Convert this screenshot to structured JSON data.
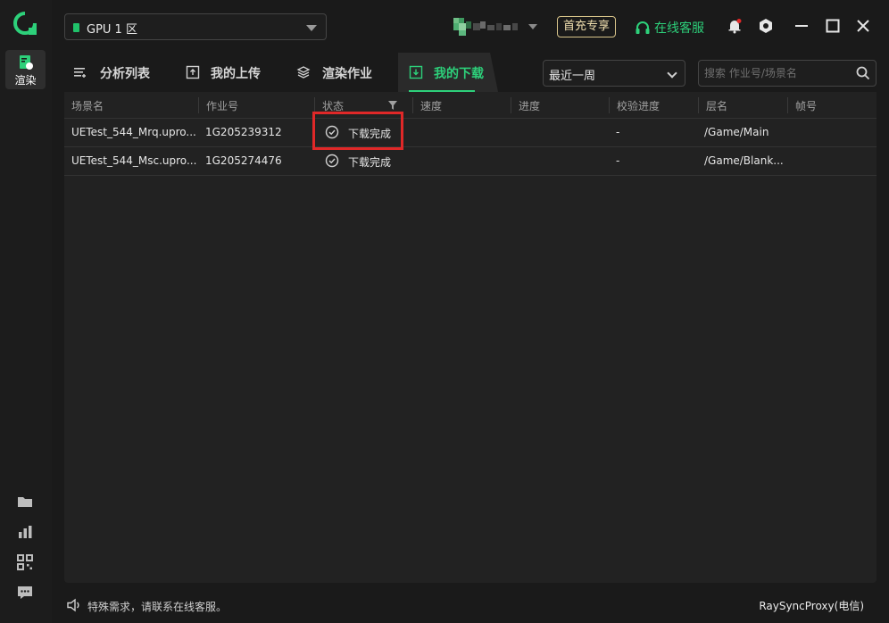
{
  "rail": {
    "render_label": "渲染"
  },
  "topbar": {
    "gpu_region": "GPU 1 区",
    "vip_label": "首充专享",
    "service_label": "在线客服"
  },
  "tabs": [
    {
      "label": "分析列表",
      "icon": "list-icon"
    },
    {
      "label": "我的上传",
      "icon": "upload-icon"
    },
    {
      "label": "渲染作业",
      "icon": "layers-icon"
    },
    {
      "label": "我的下载",
      "icon": "download-icon",
      "active": true
    }
  ],
  "filters": {
    "date_range": "最近一周",
    "search_placeholder": "搜索 作业号/场景名"
  },
  "table": {
    "headers": [
      "场景名",
      "作业号",
      "状态",
      "速度",
      "进度",
      "校验进度",
      "层名",
      "帧号"
    ],
    "rows": [
      {
        "scene": "UETest_544_Mrq.upro...",
        "job": "1G205239312",
        "status": "下载完成",
        "speed": "",
        "progress": "",
        "verify": "-",
        "layer": "/Game/Main",
        "frame": ""
      },
      {
        "scene": "UETest_544_Msc.upro...",
        "job": "1G205274476",
        "status": "下载完成",
        "speed": "",
        "progress": "",
        "verify": "-",
        "layer": "/Game/Blank...",
        "frame": ""
      }
    ]
  },
  "footer": {
    "notice": "特殊需求，请联系在线客服。",
    "proxy": "RaySyncProxy(电信)"
  },
  "colors": {
    "accent": "#2dd07a",
    "highlight_box": "#e02828",
    "vip": "#d8c48a"
  }
}
